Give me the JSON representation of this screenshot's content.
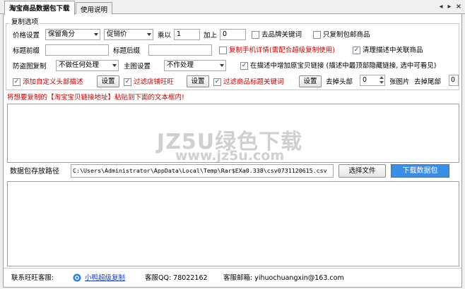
{
  "tabs": [
    {
      "label": "淘宝商品数据包下载"
    },
    {
      "label": "使用说明"
    }
  ],
  "tab_controls": {
    "prev": "◂",
    "next": "▸",
    "close": "×"
  },
  "copy_options": {
    "title": "复制选项",
    "price_label": "价格设置",
    "price_type": "保留角分",
    "price_source": "促销价",
    "multiply_label": "乘以",
    "multiply_value": "1",
    "plus_label": "加上",
    "plus_value": "0",
    "remove_brand_keywords": "去品牌关键词",
    "only_free_shipping": "只复制包邮商品",
    "title_prefix_label": "标题前缀",
    "title_prefix_value": "",
    "title_suffix_label": "标题后缀",
    "title_suffix_value": "",
    "copy_mobile_details": "复制手机详情(需配合超级复制使用)",
    "clean_related_products": "清理描述中关联商品",
    "anti_theft_label": "防盗图复制",
    "anti_theft_value": "不做任何处理",
    "main_image_label": "主图设置",
    "main_image_value": "不作处理",
    "add_original_link": "在描述中增加原宝贝链接 (描述中最顶部隐藏链接, 选中可看见)",
    "add_custom_header": "添加自定义头部描述",
    "settings_button": "设置",
    "filter_shop_wangwang": "过滤店铺旺旺",
    "filter_title_keywords": "过滤商品标题关键词",
    "remove_head_label": "去掉头部",
    "remove_head_value": "0",
    "images_label": "张图片",
    "remove_tail_label": "去掉尾部",
    "remove_tail_value": "0"
  },
  "instruction": "将想要复制的【淘宝宝贝链接地址】粘贴到下面的文本框内!",
  "watermark": {
    "line1": "JZ5U绿色下载",
    "line2": "www.jz5u.com"
  },
  "save_path": {
    "label": "数据包存放路径",
    "value": "C:\\Users\\Administrator\\AppData\\Local\\Temp\\Rar$EXa0.338\\csv0731120615.csv",
    "choose_button": "选择文件",
    "download_button": "下载数据包"
  },
  "footer": {
    "contact_label": "联系旺旺客服:",
    "wangwang_link": "小鸭超级复制",
    "qq_label": "客服QQ: 78022162",
    "email_label": "客服邮箱: yihuochuangxin@163.com"
  },
  "checkbox_states": {
    "remove_brand_keywords": false,
    "only_free_shipping": false,
    "copy_mobile_details": false,
    "clean_related_products": true,
    "add_original_link": true,
    "add_custom_header": true,
    "filter_shop_wangwang": true,
    "filter_title_keywords": true
  },
  "colors": {
    "accent_red": "#cc0000",
    "primary_blue": "#3a8ee6",
    "link_blue": "#1a3ec8"
  }
}
